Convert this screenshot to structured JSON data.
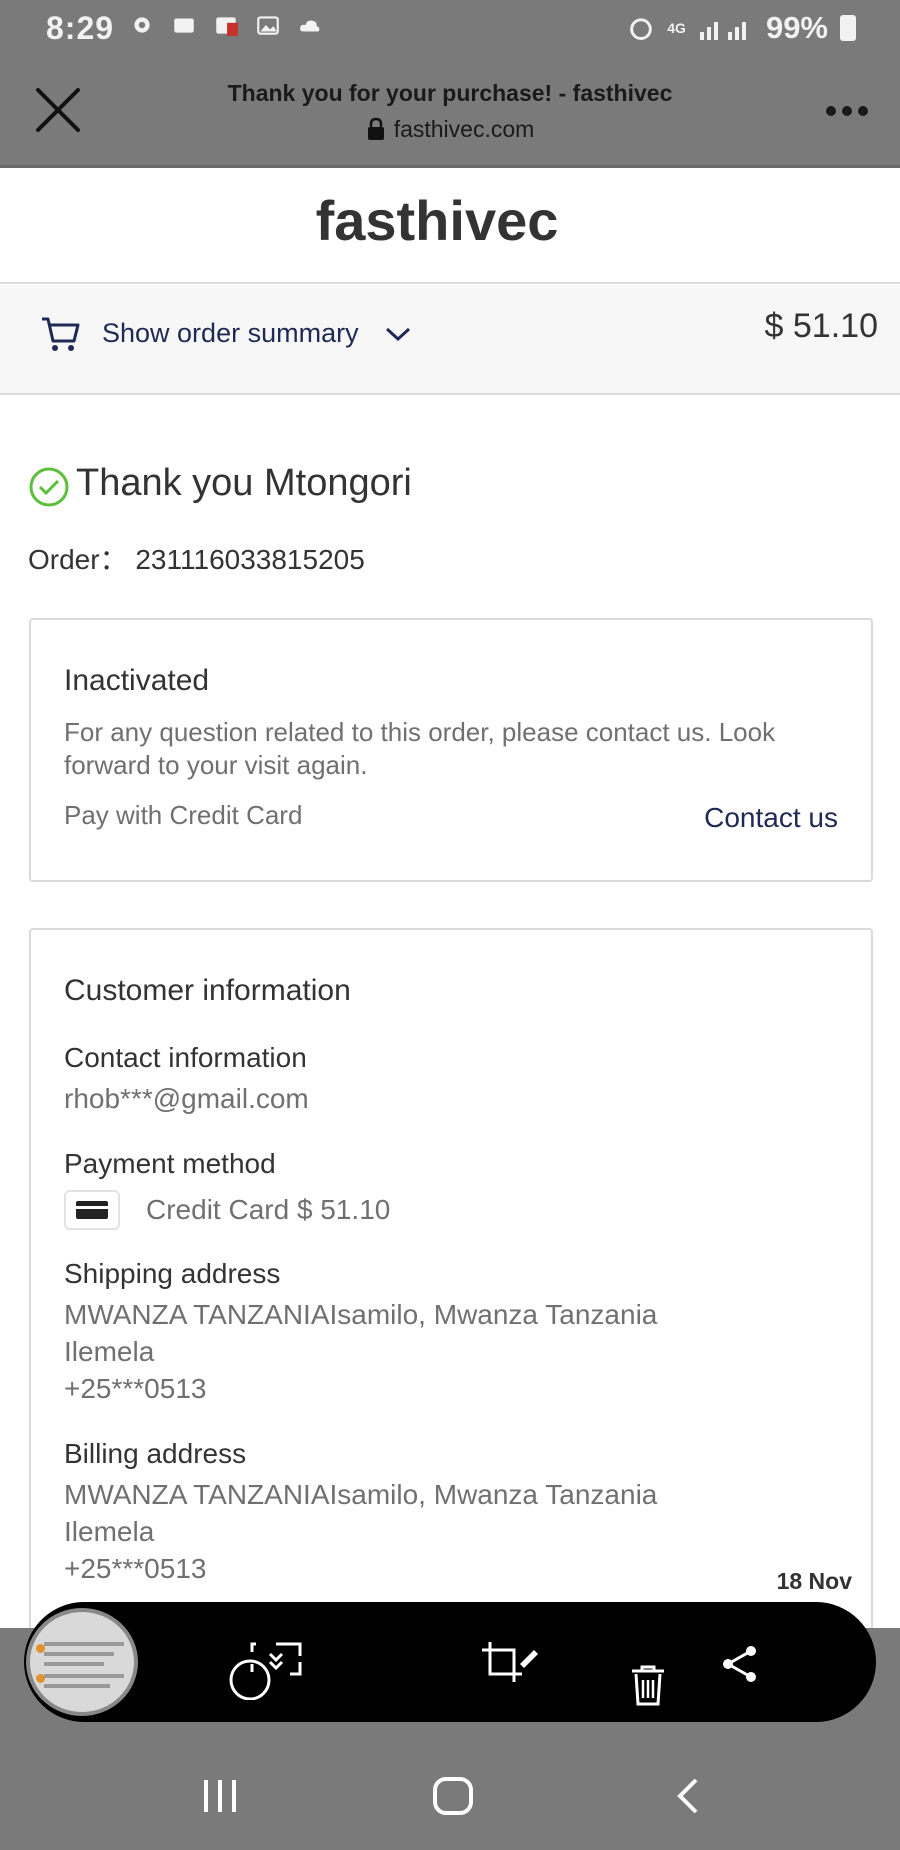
{
  "status_bar": {
    "time": "8:29",
    "battery": "99%",
    "network": "4G",
    "icons": [
      "settings-icon",
      "video-icon",
      "gallery-icon",
      "image-icon",
      "cloud-icon",
      "alarm-icon",
      "signal-icon",
      "battery-icon"
    ]
  },
  "browser": {
    "title": "Thank you for your purchase! - fasthivec",
    "url": "fasthivec.com"
  },
  "store": {
    "name": "fasthivec"
  },
  "summary": {
    "toggle_label": "Show order summary",
    "total": "$ 51.10"
  },
  "thanks": {
    "heading": "Thank you Mtongori",
    "order_label": "Order：",
    "order_number": "231116033815205"
  },
  "status_card": {
    "title": "Inactivated",
    "description": "For any question related to this order, please contact us. Look forward to your visit again.",
    "payment": "Pay with Credit Card",
    "contact_label": "Contact us"
  },
  "customer": {
    "title": "Customer information",
    "contact_label": "Contact information",
    "email": "rhob***@gmail.com",
    "payment_label": "Payment method",
    "payment_value": "Credit Card $ 51.10",
    "shipping_label": "Shipping address",
    "shipping_lines": [
      "MWANZA TANZANIAIsamilo, Mwanza Tanzania",
      "Ilemela",
      "+25***0513"
    ],
    "billing_label": "Billing address",
    "billing_lines": [
      "MWANZA TANZANIAIsamilo, Mwanza Tanzania",
      "Ilemela",
      "+25***0513"
    ]
  },
  "screenshot_toolbar": {
    "date": "18 Nov"
  },
  "colors": {
    "accent_text": "#1e2a55",
    "success_green": "#5bbf3a",
    "chrome_gray": "#7a7a7a"
  }
}
